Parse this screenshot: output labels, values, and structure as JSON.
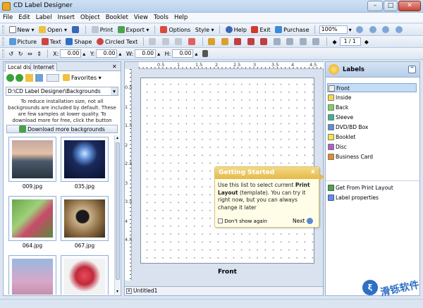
{
  "window": {
    "title": "CD Label Designer",
    "min": "–",
    "max": "□",
    "close": "✕"
  },
  "menu": [
    "File",
    "Edit",
    "Label",
    "Insert",
    "Object",
    "Booklet",
    "View",
    "Tools",
    "Help"
  ],
  "toolbar1": {
    "new": "New",
    "open": "Open",
    "print": "Print",
    "export": "Export",
    "options": "Options",
    "style": "Style",
    "help": "Help",
    "exit": "Exit",
    "purchase": "Purchase",
    "zoom": "100%"
  },
  "toolbar2": {
    "picture": "Picture",
    "text": "Text",
    "shape": "Shape",
    "circled_text": "Circled Text",
    "page_counter": "1 / 1"
  },
  "toolbar3": {
    "x_label": "X:",
    "x_value": "0.00",
    "y_label": "Y:",
    "y_value": "0.00",
    "w_label": "W:",
    "w_value": "0.00",
    "h_label": "H:",
    "h_value": "0.00"
  },
  "left_panel": {
    "tabs": [
      "Local disk",
      "Internet"
    ],
    "favorites": "Favorites",
    "path": "D:\\CD Label Designer\\Backgrounds",
    "info": "To reduce installation size, not all backgrounds are included by default. These are few samples at lower quality. To download more for free, click the button below.",
    "download_button": "Download more backgrounds",
    "thumbnails": [
      {
        "label": "009.jpg"
      },
      {
        "label": "035.jpg"
      },
      {
        "label": "064.jpg"
      },
      {
        "label": "067.jpg"
      },
      {
        "label": ""
      },
      {
        "label": ""
      }
    ]
  },
  "canvas": {
    "page_label": "Front",
    "ruler_h": [
      "0.5",
      "1",
      "1.5",
      "2",
      "2.5",
      "3",
      "3.5",
      "4",
      "4.5"
    ],
    "ruler_v": [
      "0.5",
      "1",
      "1.5",
      "2",
      "2.5",
      "3",
      "3.5",
      "4",
      "4.5"
    ],
    "document_tab": "Untitled1"
  },
  "labels_panel": {
    "title": "Labels",
    "items": [
      {
        "label": "Front",
        "color": "#f0f0f0"
      },
      {
        "label": "Inside",
        "color": "#f5d94a"
      },
      {
        "label": "Back",
        "color": "#7fd25a"
      },
      {
        "label": "Sleeve",
        "color": "#36b39a"
      },
      {
        "label": "DVD/BD Box",
        "color": "#5a8fd8"
      },
      {
        "label": "Booklet",
        "color": "#f2e44a"
      },
      {
        "label": "Disc",
        "color": "#b05ec9"
      },
      {
        "label": "Business Card",
        "color": "#e28b2c"
      }
    ],
    "actions": [
      "Get From Print Layout",
      "Label properties"
    ]
  },
  "getting_started": {
    "title": "Getting Started",
    "close": "x",
    "body_pre": "Use this list to select current ",
    "body_bold": "Print Layout",
    "body_post": " (template). You can try it right now, but you can always change it later",
    "checkbox": "Don't show again",
    "next": "Next"
  },
  "watermark": "滑铄软件"
}
